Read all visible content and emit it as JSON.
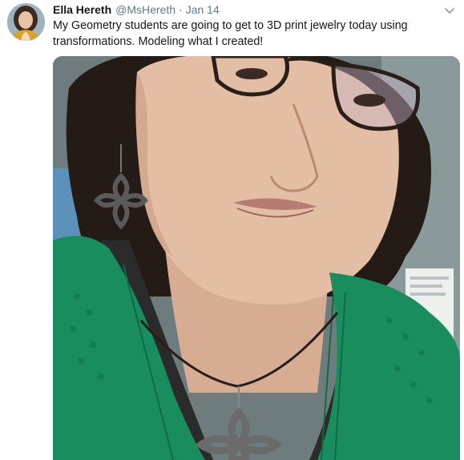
{
  "tweet": {
    "author_name": "Ella Hereth",
    "author_handle": "@MsHereth",
    "separator": "·",
    "timestamp": "Jan 14",
    "text": "My Geometry students are going to get to 3D print jewelry today using transformations. Modeling what I created!"
  },
  "icons": {
    "menu": "chevron-down-icon",
    "avatar": "profile-photo",
    "media": "selfie-photo-with-3d-printed-pendant-and-earring"
  },
  "colors": {
    "name": "#14171a",
    "secondary": "#657786",
    "shirt": "#1a8d5f",
    "background": "#ffffff"
  }
}
